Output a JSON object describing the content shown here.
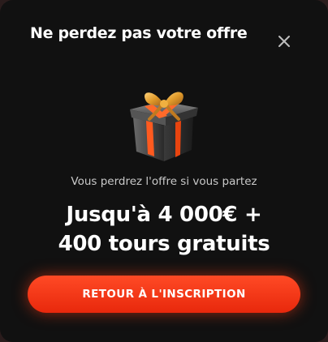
{
  "modal": {
    "title": "Ne perdez pas votre offre",
    "close_icon": "close-icon",
    "image_icon": "gift-box-icon",
    "subtitle": "Vous perdrez l'offre si vous partez",
    "headline_line1": "Jusqu'à 4 000€ +",
    "headline_line2": "400 tours gratuits",
    "cta_label": "RETOUR À L'INSCRIPTION"
  },
  "colors": {
    "background": "#111111",
    "accent": "#ff4a25",
    "text": "#ffffff",
    "muted_text": "#c9c9c9"
  }
}
